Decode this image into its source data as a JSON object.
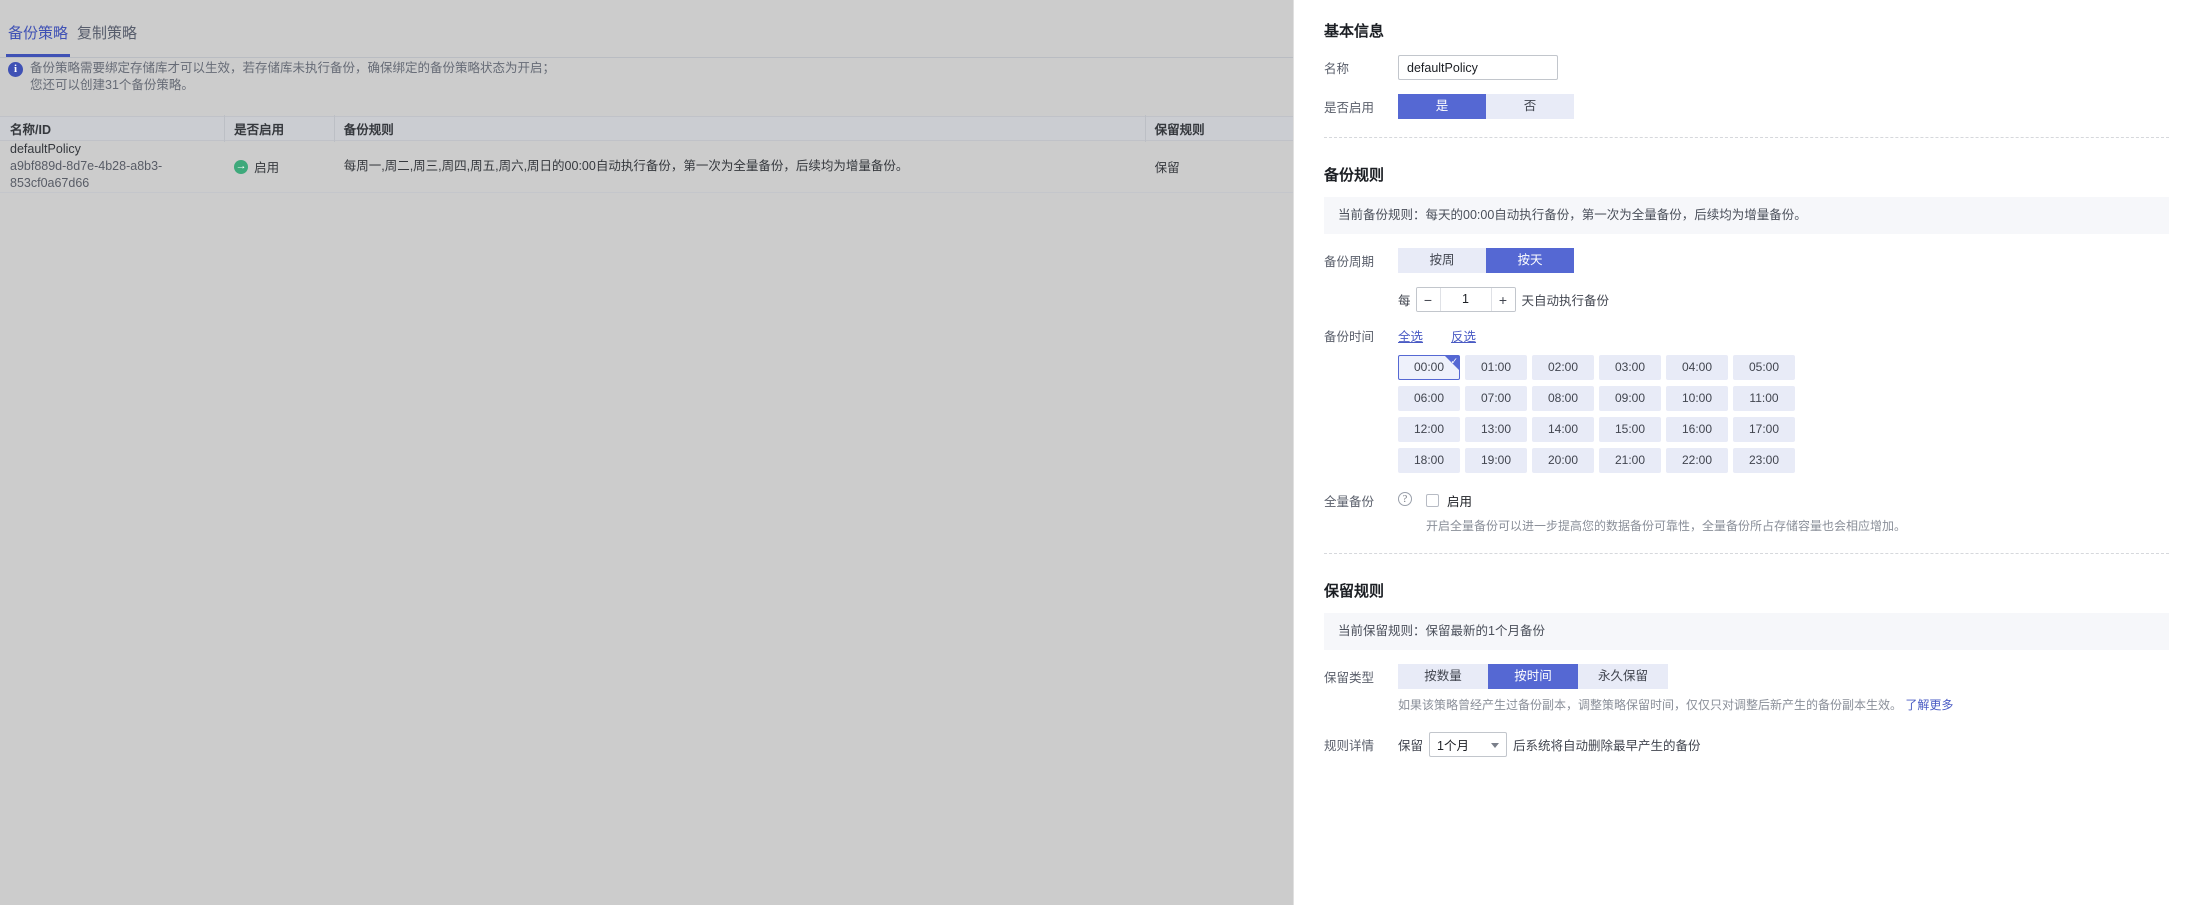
{
  "background_page": {
    "tabs": [
      {
        "label": "备份策略",
        "active": true
      },
      {
        "label": "复制策略",
        "active": false
      }
    ],
    "banner": {
      "icon": "info-icon",
      "line1": "备份策略需要绑定存储库才可以生效，若存储库未执行备份，确保绑定的备份策略状态为开启；",
      "line2": "您还可以创建31个备份策略。"
    },
    "table": {
      "columns": [
        "名称/ID",
        "是否启用",
        "备份规则",
        "保留规则"
      ],
      "rows": [
        {
          "name": "defaultPolicy",
          "id": "a9bf889d-8d7e-4b28-a8b3-853cf0a67d66",
          "enabled_label": "启用",
          "enabled_icon": "arrow-circle-icon",
          "rule": "每周一,周二,周三,周四,周五,周六,周日的00:00自动执行备份，第一次为全量备份，后续均为增量备份。",
          "retain": "保留"
        }
      ]
    }
  },
  "panel": {
    "basic": {
      "title": "基本信息",
      "name_label": "名称",
      "name_value": "defaultPolicy",
      "name_placeholder": "",
      "enable_label": "是否启用",
      "enable_options": [
        {
          "label": "是",
          "selected": true
        },
        {
          "label": "否",
          "selected": false
        }
      ]
    },
    "backup_rule": {
      "title": "备份规则",
      "current_notice": "当前备份规则：每天的00:00自动执行备份，第一次为全量备份，后续均为增量备份。",
      "cycle_label": "备份周期",
      "cycle_options": [
        {
          "label": "按周",
          "selected": false
        },
        {
          "label": "按天",
          "selected": true
        }
      ],
      "stepper_prefix": "每",
      "stepper_minus": "−",
      "stepper_value": "1",
      "stepper_plus": "+",
      "stepper_suffix": "天自动执行备份",
      "time_label": "备份时间",
      "select_all": "全选",
      "invert_select": "反选",
      "times": [
        {
          "label": "00:00",
          "selected": true
        },
        {
          "label": "01:00",
          "selected": false
        },
        {
          "label": "02:00",
          "selected": false
        },
        {
          "label": "03:00",
          "selected": false
        },
        {
          "label": "04:00",
          "selected": false
        },
        {
          "label": "05:00",
          "selected": false
        },
        {
          "label": "06:00",
          "selected": false
        },
        {
          "label": "07:00",
          "selected": false
        },
        {
          "label": "08:00",
          "selected": false
        },
        {
          "label": "09:00",
          "selected": false
        },
        {
          "label": "10:00",
          "selected": false
        },
        {
          "label": "11:00",
          "selected": false
        },
        {
          "label": "12:00",
          "selected": false
        },
        {
          "label": "13:00",
          "selected": false
        },
        {
          "label": "14:00",
          "selected": false
        },
        {
          "label": "15:00",
          "selected": false
        },
        {
          "label": "16:00",
          "selected": false
        },
        {
          "label": "17:00",
          "selected": false
        },
        {
          "label": "18:00",
          "selected": false
        },
        {
          "label": "19:00",
          "selected": false
        },
        {
          "label": "20:00",
          "selected": false
        },
        {
          "label": "21:00",
          "selected": false
        },
        {
          "label": "22:00",
          "selected": false
        },
        {
          "label": "23:00",
          "selected": false
        }
      ],
      "full_backup_label": "全量备份",
      "full_backup_help": "?",
      "full_backup_checkbox_label": "启用",
      "full_backup_checked": false,
      "full_backup_hint": "开启全量备份可以进一步提高您的数据备份可靠性，全量备份所占存储容量也会相应增加。"
    },
    "retention_rule": {
      "title": "保留规则",
      "current_notice": "当前保留规则：保留最新的1个月备份",
      "type_label": "保留类型",
      "type_options": [
        {
          "label": "按数量",
          "selected": false
        },
        {
          "label": "按时间",
          "selected": true
        },
        {
          "label": "永久保留",
          "selected": false
        }
      ],
      "hint": "如果该策略曾经产生过备份副本，调整策略保留时间，仅仅只对调整后新产生的备份副本生效。",
      "hint_link": "了解更多",
      "detail_label": "规则详情",
      "detail_prefix": "保留",
      "detail_select_value": "1个月",
      "detail_suffix": "后系统将自动删除最早产生的备份"
    }
  }
}
